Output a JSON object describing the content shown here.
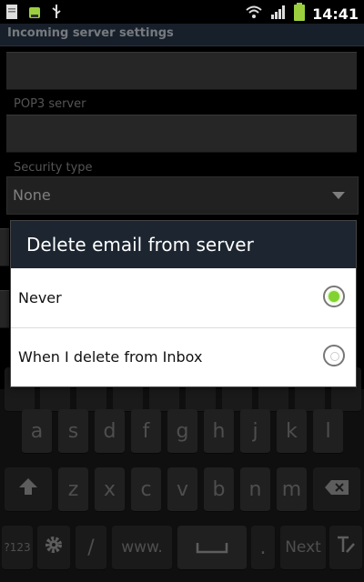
{
  "status": {
    "time": "14:41"
  },
  "header": {
    "title": "Incoming server settings"
  },
  "form": {
    "pop3_label": "POP3 server",
    "security_label": "Security type",
    "security_value": "None"
  },
  "dialog": {
    "title": "Delete email from server",
    "options": [
      {
        "label": "Never",
        "selected": true
      },
      {
        "label": "When I delete from Inbox",
        "selected": false
      }
    ]
  },
  "keyboard": {
    "row2": [
      "a",
      "s",
      "d",
      "f",
      "g",
      "h",
      "j",
      "k",
      "l"
    ],
    "row3": [
      "z",
      "x",
      "c",
      "v",
      "b",
      "n",
      "m"
    ],
    "mode_label": "?123",
    "www_label": "www.",
    "period_label": ".",
    "next_label": "Next",
    "slash_label": "/"
  }
}
